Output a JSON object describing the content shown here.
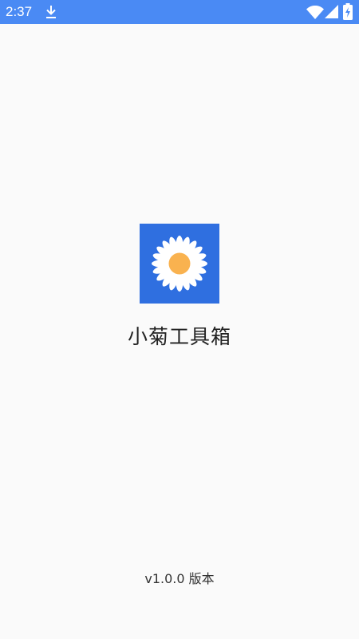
{
  "theme": {
    "status_bar_color": "#4a8af4",
    "icon_background": "#2f6fe0",
    "petal_color": "#ffffff",
    "flower_center": "#f9b24f",
    "page_background": "#fafafa"
  },
  "status_bar": {
    "time": "2:37",
    "left_icons": [
      "download-icon"
    ],
    "right_icons": [
      "wifi-icon",
      "cell-signal-icon",
      "battery-charging-icon"
    ]
  },
  "splash": {
    "app_icon": "daisy-icon",
    "app_name": "小菊工具箱",
    "version": "v1.0.0 版本"
  }
}
